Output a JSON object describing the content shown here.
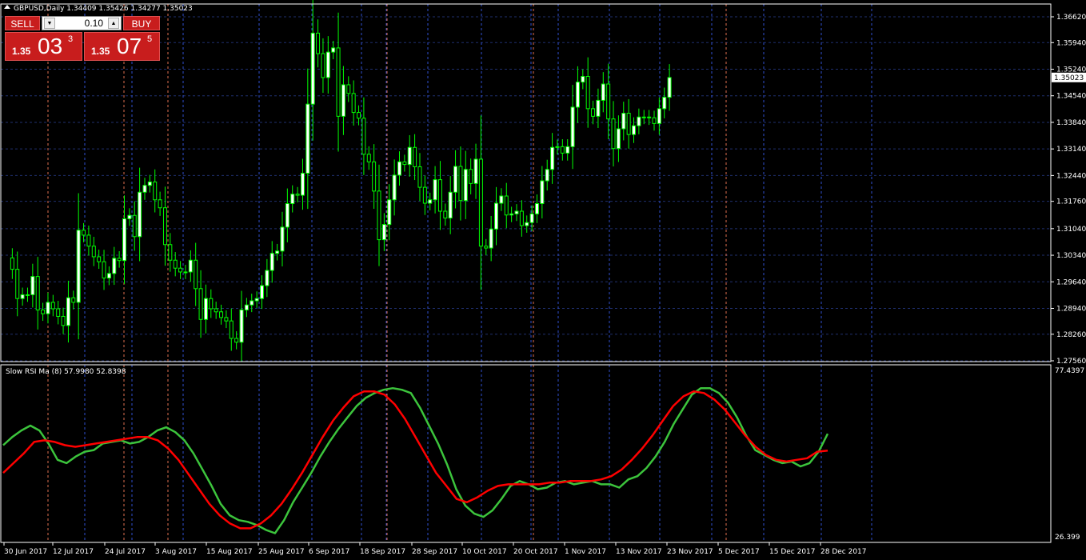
{
  "header": {
    "symbol_line": "GBPUSD,Daily  1.34409 1.35426 1.34277 1.35023",
    "indicator_line": "Slow RSI Ma (8) 57.9980 52.8398"
  },
  "trade_panel": {
    "sell_label": "SELL",
    "buy_label": "BUY",
    "lot_value": "0.10",
    "sell_price": {
      "big": "1.35",
      "mid": "03",
      "sup": "3"
    },
    "buy_price": {
      "big": "1.35",
      "mid": "07",
      "sup": "5"
    }
  },
  "colors": {
    "background": "#000000",
    "grid": "#1f2f6e",
    "candle_up": "#ffffff",
    "candle_wick": "#00ff00",
    "rsi_fast": "#3cc43c",
    "rsi_slow": "#ff0000",
    "vline_orange": "#e07050",
    "vline_blue": "#3050d0"
  },
  "chart_data": [
    {
      "type": "candlestick",
      "ylim": [
        1.2756,
        1.3662
      ],
      "y_ticks": [
        "1.36620",
        "1.35940",
        "1.35240",
        "1.34540",
        "1.33840",
        "1.33140",
        "1.32440",
        "1.31760",
        "1.31040",
        "1.30340",
        "1.29640",
        "1.28940",
        "1.28260",
        "1.27560"
      ],
      "current_price_label": "1.35023",
      "current_price": 1.35023,
      "x_labels": [
        "30 Jun 2017",
        "12 Jul 2017",
        "24 Jul 2017",
        "3 Aug 2017",
        "15 Aug 2017",
        "25 Aug 2017",
        "6 Sep 2017",
        "18 Sep 2017",
        "28 Sep 2017",
        "10 Oct 2017",
        "20 Oct 2017",
        "1 Nov 2017",
        "13 Nov 2017",
        "23 Nov 2017",
        "5 Dec 2017",
        "15 Dec 2017",
        "28 Dec 2017"
      ],
      "closes": [
        1.3027,
        1.2997,
        1.292,
        1.293,
        1.293,
        1.2978,
        1.289,
        1.288,
        1.291,
        1.2893,
        1.2873,
        1.2849,
        1.2922,
        1.291,
        1.31,
        1.3087,
        1.3058,
        1.303,
        1.3017,
        1.2974,
        1.2986,
        1.3026,
        1.302,
        1.313,
        1.3139,
        1.3083,
        1.32,
        1.3218,
        1.3227,
        1.318,
        1.3159,
        1.3062,
        1.3021,
        1.3,
        1.299,
        1.299,
        1.3021,
        1.2946,
        1.2865,
        1.292,
        1.2893,
        1.2885,
        1.287,
        1.2861,
        1.2815,
        1.2805,
        1.289,
        1.2903,
        1.2914,
        1.292,
        1.2954,
        1.2994,
        1.3039,
        1.3045,
        1.3108,
        1.317,
        1.3195,
        1.3192,
        1.325,
        1.3432,
        1.3619,
        1.3565,
        1.3502,
        1.3569,
        1.358,
        1.34,
        1.3483,
        1.346,
        1.341,
        1.3395,
        1.33,
        1.328,
        1.3203,
        1.3075,
        1.3115,
        1.318,
        1.3245,
        1.328,
        1.3273,
        1.3318,
        1.3267,
        1.3213,
        1.3171,
        1.318,
        1.3233,
        1.315,
        1.3132,
        1.32,
        1.3268,
        1.3178,
        1.326,
        1.3223,
        1.3287,
        1.3058,
        1.3053,
        1.3103,
        1.3171,
        1.319,
        1.314,
        1.3143,
        1.315,
        1.3112,
        1.312,
        1.3143,
        1.317,
        1.323,
        1.326,
        1.3318,
        1.332,
        1.3303,
        1.332,
        1.3424,
        1.349,
        1.3505,
        1.342,
        1.34,
        1.3442,
        1.3485,
        1.3393,
        1.3315,
        1.3367,
        1.3408,
        1.3352,
        1.3375,
        1.3398,
        1.3398,
        1.3396,
        1.3381,
        1.342,
        1.345,
        1.3502
      ]
    },
    {
      "type": "line",
      "ylim": [
        26.399,
        77.4397
      ],
      "y_ticks": [
        "77.4397",
        "26.399"
      ],
      "series": [
        {
          "name": "fast",
          "color": "#3cc43c",
          "values": [
            54.5,
            57.0,
            59.0,
            60.5,
            59.0,
            55.0,
            50.0,
            49.0,
            51.0,
            52.5,
            53.0,
            55.0,
            55.5,
            56.0,
            55.0,
            55.5,
            57.0,
            59.0,
            60.0,
            58.5,
            56.0,
            52.0,
            47.0,
            42.0,
            36.5,
            33.0,
            31.5,
            31.0,
            30.0,
            28.5,
            27.5,
            31.5,
            37.0,
            41.5,
            46.0,
            51.0,
            55.5,
            59.5,
            63.0,
            66.5,
            69.0,
            70.5,
            71.5,
            72.0,
            71.5,
            70.5,
            66.0,
            60.5,
            55.0,
            48.5,
            41.0,
            36.0,
            33.5,
            32.5,
            34.5,
            38.0,
            42.0,
            43.5,
            42.5,
            41.0,
            41.5,
            43.0,
            43.5,
            42.5,
            43.0,
            43.5,
            42.5,
            42.5,
            41.5,
            44.0,
            45.0,
            47.5,
            51.0,
            55.5,
            61.0,
            65.5,
            70.0,
            72.0,
            72.0,
            70.5,
            67.5,
            63.0,
            57.5,
            53.0,
            51.5,
            50.0,
            49.0,
            49.5,
            48.0,
            49.0,
            52.5,
            57.998
          ]
        },
        {
          "name": "slow",
          "color": "#ff0000",
          "values": [
            46.0,
            49.0,
            52.0,
            55.5,
            56.0,
            55.5,
            54.5,
            54.0,
            54.5,
            55.0,
            55.5,
            56.0,
            56.5,
            57.0,
            57.0,
            56.0,
            53.5,
            50.0,
            45.5,
            41.0,
            36.5,
            33.0,
            30.5,
            29.0,
            29.0,
            30.5,
            33.0,
            36.5,
            41.0,
            46.0,
            51.5,
            57.0,
            62.0,
            66.0,
            69.5,
            71.0,
            71.0,
            70.0,
            67.0,
            62.5,
            57.0,
            51.5,
            46.0,
            42.0,
            38.0,
            37.0,
            38.5,
            40.5,
            42.0,
            42.5,
            42.5,
            42.5,
            42.5,
            43.0,
            43.0,
            43.5,
            43.5,
            43.5,
            44.0,
            45.0,
            47.0,
            50.0,
            53.5,
            57.5,
            62.0,
            66.5,
            69.5,
            71.0,
            70.5,
            68.5,
            65.5,
            61.5,
            57.5,
            54.0,
            51.5,
            50.0,
            49.5,
            50.0,
            50.5,
            52.5,
            52.8398
          ]
        }
      ]
    }
  ]
}
